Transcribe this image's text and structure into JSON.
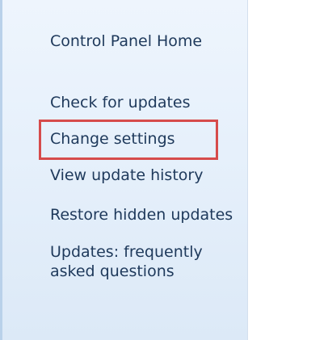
{
  "nav": {
    "home_label": "Control Panel Home",
    "items": [
      {
        "label": "Check for updates"
      },
      {
        "label": "Change settings"
      },
      {
        "label": "View update history"
      },
      {
        "label": "Restore hidden updates"
      },
      {
        "label": "Updates: frequently asked questions"
      }
    ]
  },
  "annotation": {
    "highlight_color": "#d64b4b",
    "highlighted_item": "Change settings"
  }
}
